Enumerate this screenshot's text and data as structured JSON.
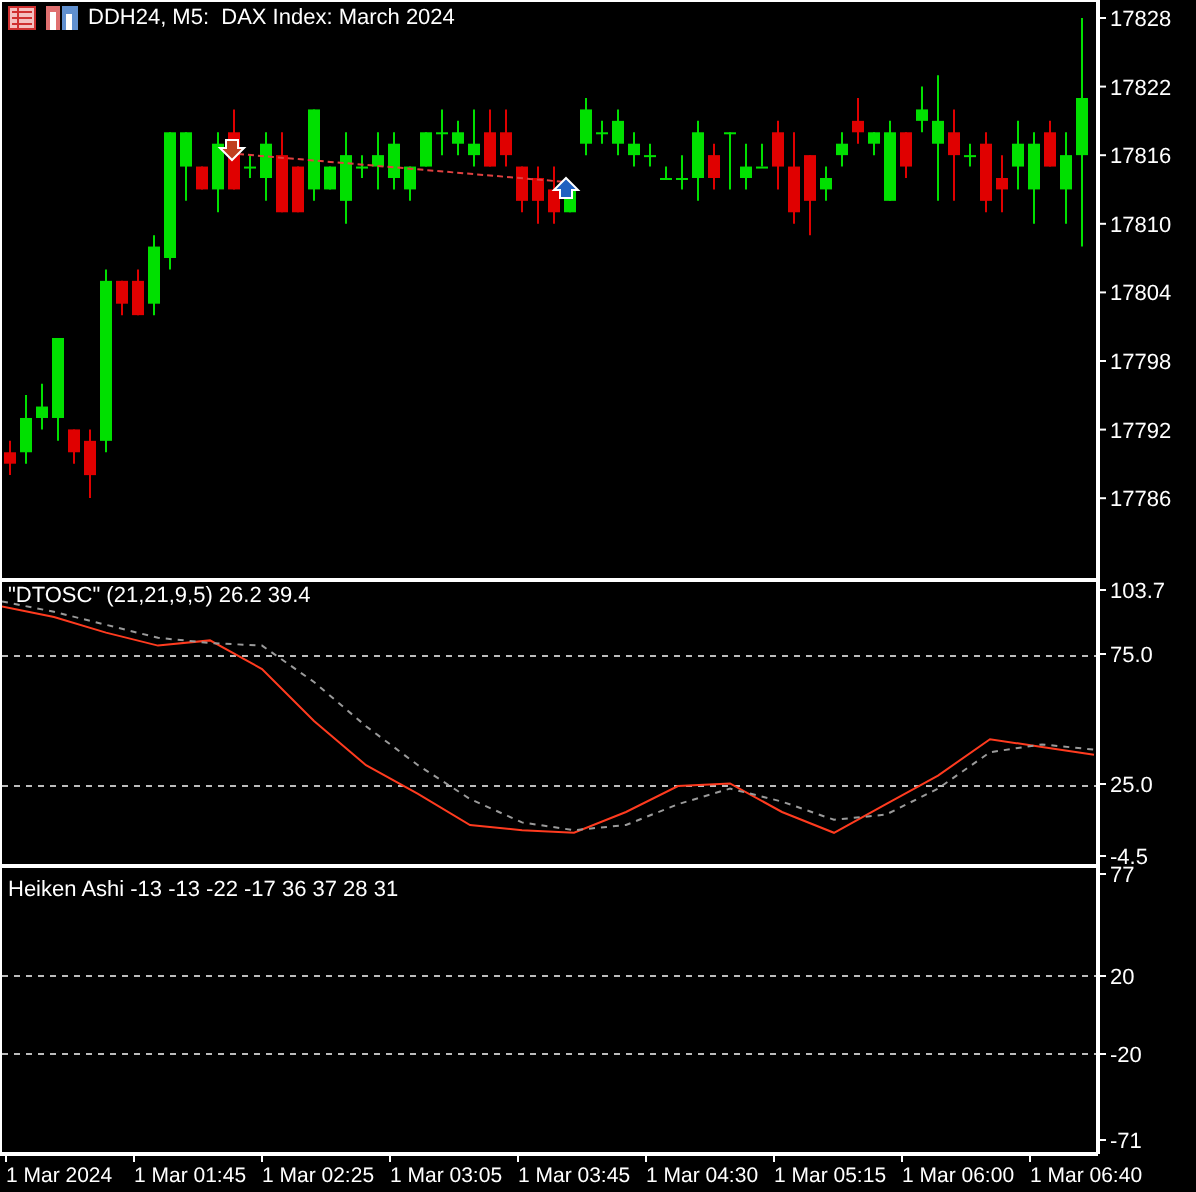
{
  "window": {
    "title": "DDH24, M5:  DAX Index: March 2024"
  },
  "price_pane": {
    "scale_labels": [
      "17828",
      "17822",
      "17816",
      "17810",
      "17804",
      "17798",
      "17792",
      "17786"
    ]
  },
  "oscillator_pane": {
    "label": "\"DTOSC\" (21,21,9,5) 26.2 39.4",
    "scale_labels": [
      "103.7",
      "75.0",
      "25.0",
      "-4.5"
    ]
  },
  "heiken_pane": {
    "label": "Heiken Ashi -13 -13 -22 -17 36 37 28 31",
    "scale_labels": [
      "77",
      "20",
      "-20",
      "-71"
    ]
  },
  "time_axis": {
    "labels": [
      "1 Mar 2024",
      "1 Mar 01:45",
      "1 Mar 02:25",
      "1 Mar 03:05",
      "1 Mar 03:45",
      "1 Mar 04:30",
      "1 Mar 05:15",
      "1 Mar 06:00",
      "1 Mar 06:40"
    ]
  }
}
